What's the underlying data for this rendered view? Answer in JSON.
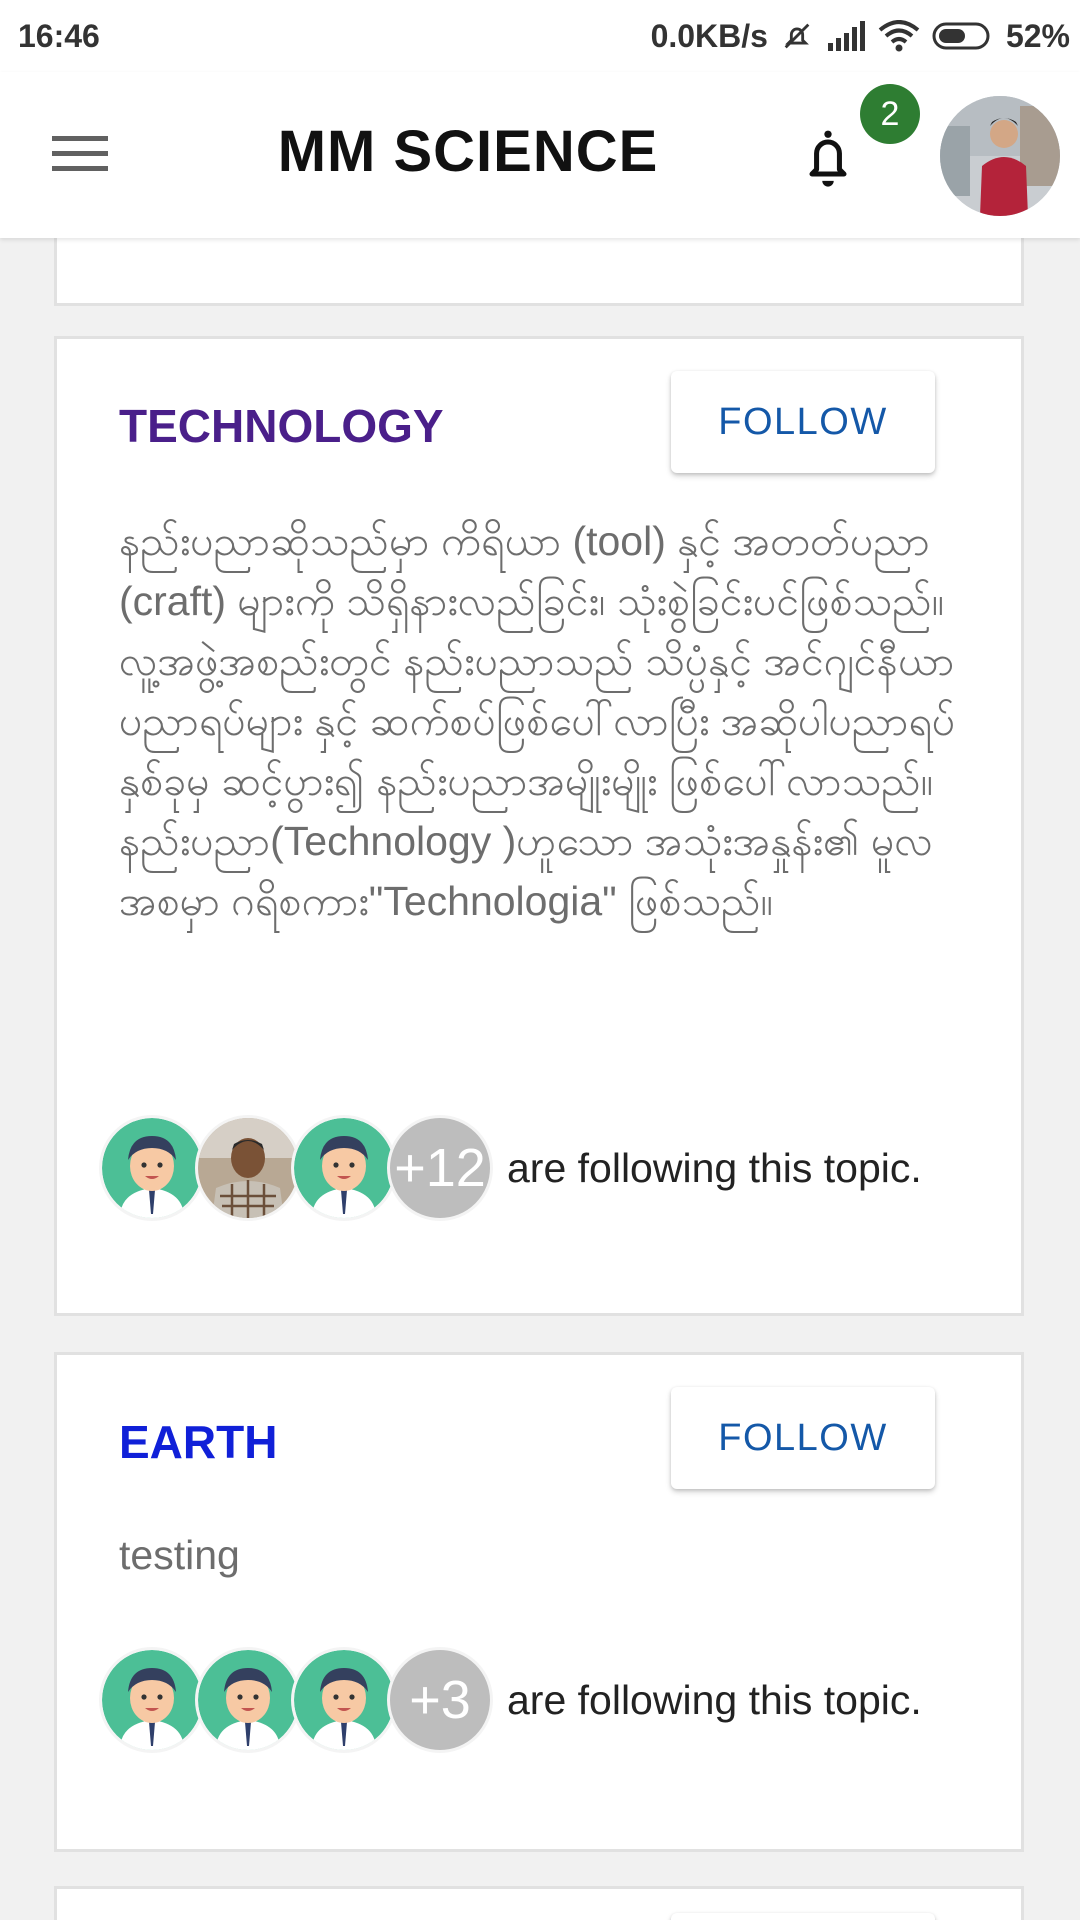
{
  "status_bar": {
    "time": "16:46",
    "network_speed": "0.0KB/s",
    "battery": "52%",
    "icons": [
      "muted-icon",
      "signal-icon",
      "wifi-icon",
      "battery-icon"
    ]
  },
  "app_bar": {
    "title": "MM SCIENCE",
    "notification_count": "2",
    "icons": [
      "menu-icon",
      "bell-icon"
    ]
  },
  "colors": {
    "technology": "#4a1f8a",
    "earth": "#1020d8",
    "follow_text": "#1458a8",
    "badge": "#2e7d32"
  },
  "topics": [
    {
      "name": "TECHNOLOGY",
      "follow_label": "FOLLOW",
      "description": "နည်းပညာဆိုသည်မှာ ကိရိယာ (tool) နှင့် အတတ်ပညာ (craft) များကို သိရှိနားလည်ခြင်း၊ သုံးစွဲခြင်းပင်ဖြစ်သည်။လူ့အဖွဲ့အစည်းတွင် နည်းပညာသည် သိပ္ပံနှင့် အင်ဂျင်နီယာပညာရပ်များ နှင့် ဆက်စပ်ဖြစ်ပေါ်လာပြီး အဆိုပါပညာရပ်နှစ်ခုမှ ဆင့်ပွား၍ နည်းပညာအမျိုးမျိုး ဖြစ်ပေါ်လာသည်။ နည်းပညာ(Technology )ဟူသော အသုံးအနှုန်း၏ မူလအစမှာ ဂရိစကား\"Technologia\" ဖြစ်သည်။",
      "follower_extra": "+12",
      "followers_text": "are following this topic."
    },
    {
      "name": "EARTH",
      "follow_label": "FOLLOW",
      "description": "testing",
      "follower_extra": "+3",
      "followers_text": "are following this topic."
    }
  ]
}
